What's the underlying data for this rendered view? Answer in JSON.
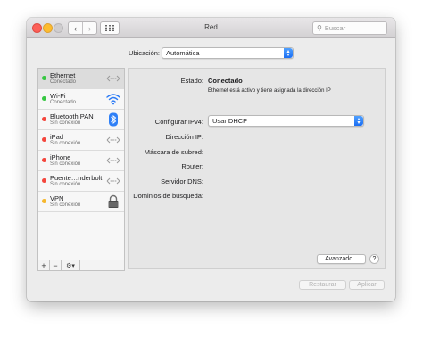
{
  "window": {
    "title": "Red",
    "search_placeholder": "Buscar",
    "nav_back": "‹",
    "nav_forward": "›",
    "grid_icon": "grid-icon"
  },
  "location": {
    "label": "Ubicación:",
    "value": "Automática"
  },
  "services": [
    {
      "name": "Ethernet",
      "status": "Conectado",
      "dot": "#37c742",
      "icon": "ethernet-icon",
      "selected": true
    },
    {
      "name": "Wi-Fi",
      "status": "Conectado",
      "dot": "#37c742",
      "icon": "wifi-icon"
    },
    {
      "name": "Bluetooth PAN",
      "status": "Sin conexión",
      "dot": "#f4463c",
      "icon": "bluetooth-icon"
    },
    {
      "name": "iPad",
      "status": "Sin conexión",
      "dot": "#f4463c",
      "icon": "ethernet-icon"
    },
    {
      "name": "iPhone",
      "status": "Sin conexión",
      "dot": "#f4463c",
      "icon": "ethernet-icon"
    },
    {
      "name": "Puente…nderbolt",
      "status": "Sin conexión",
      "dot": "#f4463c",
      "icon": "ethernet-icon"
    },
    {
      "name": "VPN",
      "status": "Sin conexión",
      "dot": "#f6b72d",
      "icon": "lock-icon"
    }
  ],
  "sidebar_toolbar": {
    "add": "+",
    "remove": "−",
    "gear": "⚙▾"
  },
  "detail": {
    "status_label": "Estado:",
    "status_value": "Conectado",
    "status_desc": "Ethernet está activo y tiene asignada la dirección IP",
    "ipv4_label": "Configurar IPv4:",
    "ipv4_value": "Usar DHCP",
    "ip_label": "Dirección IP:",
    "subnet_label": "Máscara de subred:",
    "router_label": "Router:",
    "dns_label": "Servidor DNS:",
    "search_domains_label": "Dominios de búsqueda:"
  },
  "buttons": {
    "advanced": "Avanzado...",
    "help": "?",
    "revert": "Restaurar",
    "apply": "Aplicar"
  },
  "colors": {
    "accent": "#1b6ef3",
    "connected": "#37c742",
    "disconnected": "#f4463c",
    "vpn": "#f6b72d"
  }
}
